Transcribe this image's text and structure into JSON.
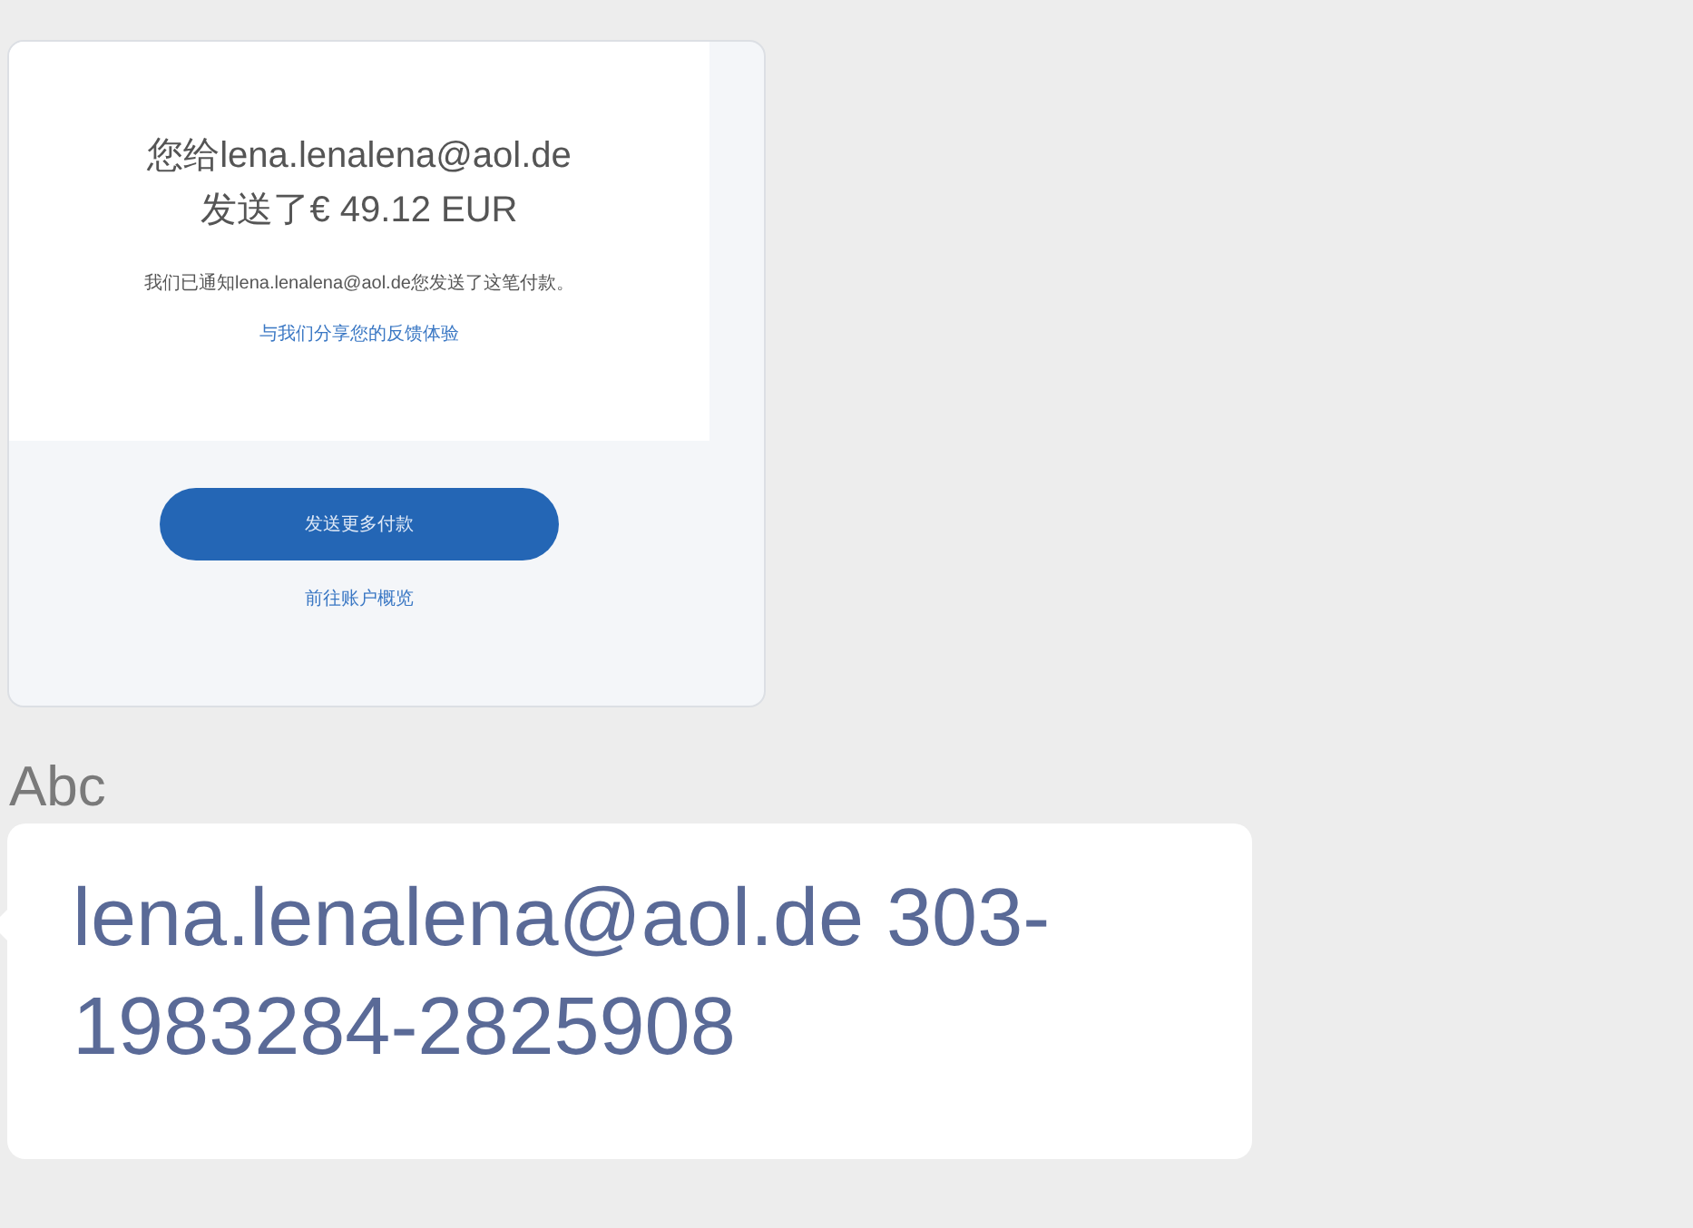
{
  "messages": [
    {
      "kind": "image",
      "screenshot": {
        "heading": [
          "您给lena.lenalena@aol.de",
          "发送了€ 49.12 EUR"
        ],
        "note": "我们已通知lena.lenalena@aol.de您发送了这笔付款。",
        "feedback_link": "与我们分享您的反馈体验",
        "primary_button": "发送更多付款",
        "secondary_link": "前往账户概览"
      }
    },
    {
      "sender": "Abc",
      "kind": "text",
      "text": "lena.lenalena@aol.de 303-1983284-2825908"
    }
  ]
}
